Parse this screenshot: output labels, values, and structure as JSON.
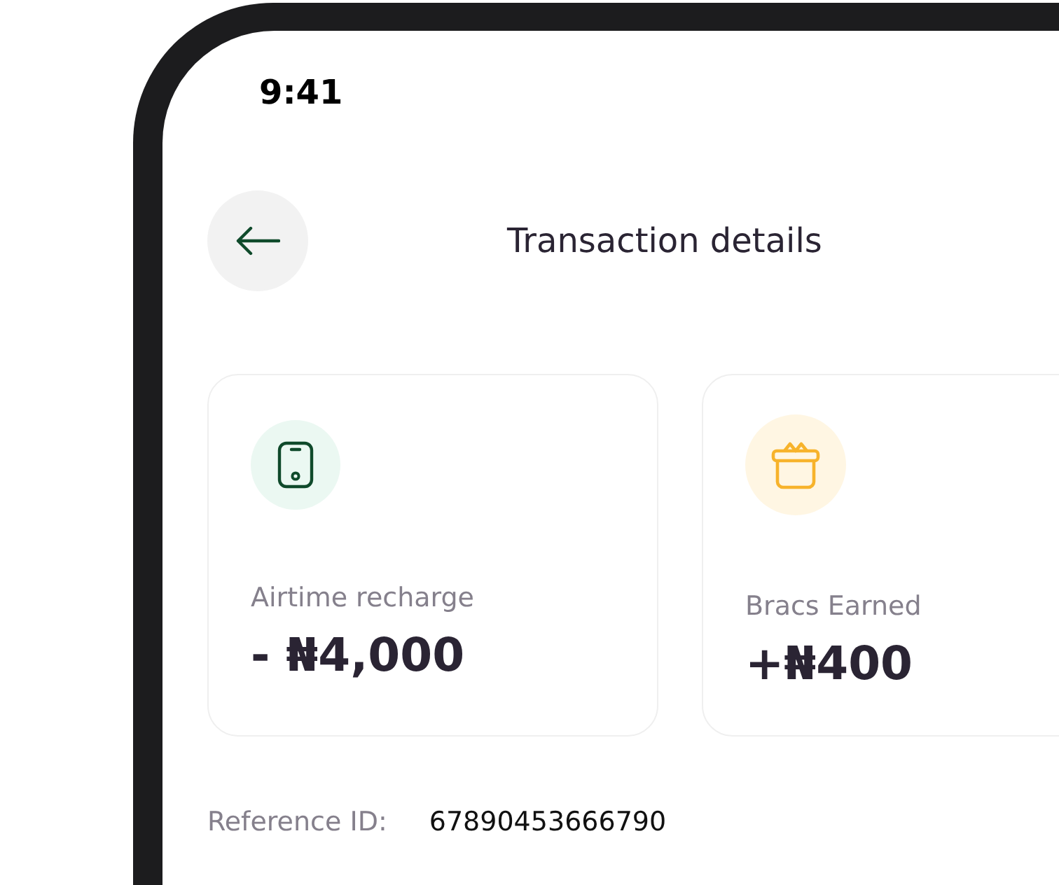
{
  "status_bar": {
    "time": "9:41"
  },
  "header": {
    "title": "Transaction details"
  },
  "cards": [
    {
      "kind": "phone",
      "label": "Airtime recharge",
      "amount": "- ₦4,000"
    },
    {
      "kind": "gift",
      "label": "Bracs Earned",
      "amount": "+₦400"
    }
  ],
  "details": [
    {
      "label": "Reference ID:",
      "value": "67890453666790"
    }
  ]
}
